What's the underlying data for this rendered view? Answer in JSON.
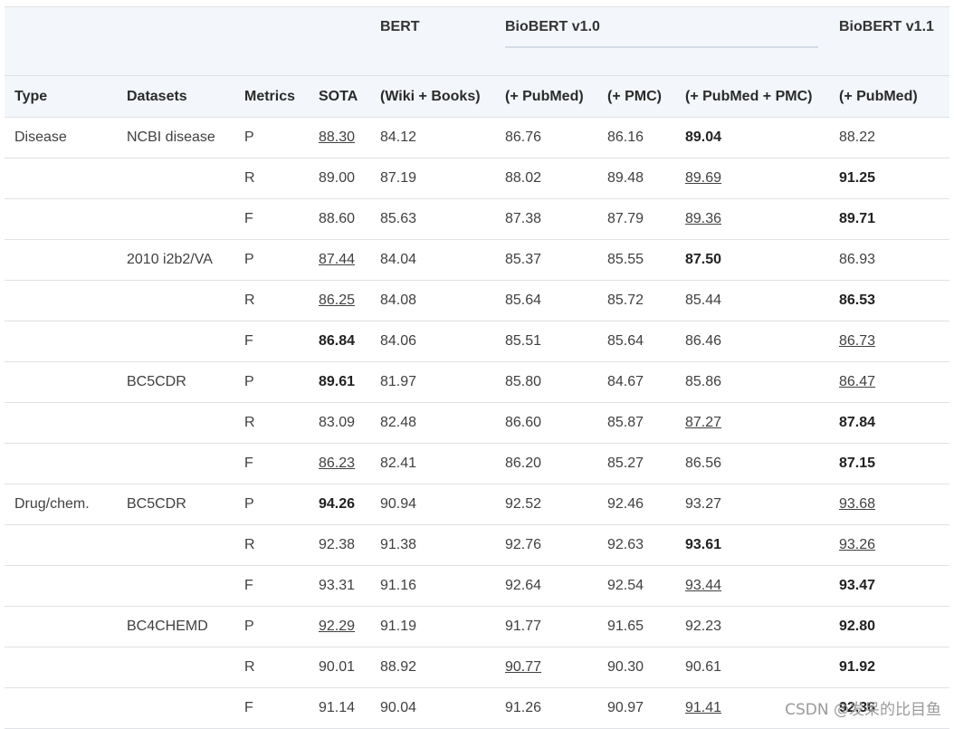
{
  "header": {
    "groups": {
      "bert": "BERT",
      "biobert_v10": "BioBERT v1.0",
      "biobert_v11": "BioBERT v1.1"
    },
    "columns": [
      "Type",
      "Datasets",
      "Metrics",
      "SOTA",
      "(Wiki + Books)",
      "(+ PubMed)",
      "(+ PMC)",
      "(+ PubMed + PMC)",
      "(+ PubMed)"
    ]
  },
  "rows": [
    {
      "cells": [
        "Disease",
        "NCBI disease",
        "P",
        "88.30",
        "84.12",
        "86.76",
        "86.16",
        "89.04",
        "88.22"
      ],
      "bold": [
        7
      ],
      "underline": [
        3
      ]
    },
    {
      "cells": [
        "",
        "",
        "R",
        "89.00",
        "87.19",
        "88.02",
        "89.48",
        "89.69",
        "91.25"
      ],
      "bold": [
        8
      ],
      "underline": [
        7
      ]
    },
    {
      "cells": [
        "",
        "",
        "F",
        "88.60",
        "85.63",
        "87.38",
        "87.79",
        "89.36",
        "89.71"
      ],
      "bold": [
        8
      ],
      "underline": [
        7
      ]
    },
    {
      "cells": [
        "",
        "2010 i2b2/VA",
        "P",
        "87.44",
        "84.04",
        "85.37",
        "85.55",
        "87.50",
        "86.93"
      ],
      "bold": [
        7
      ],
      "underline": [
        3
      ]
    },
    {
      "cells": [
        "",
        "",
        "R",
        "86.25",
        "84.08",
        "85.64",
        "85.72",
        "85.44",
        "86.53"
      ],
      "bold": [
        8
      ],
      "underline": [
        3
      ]
    },
    {
      "cells": [
        "",
        "",
        "F",
        "86.84",
        "84.06",
        "85.51",
        "85.64",
        "86.46",
        "86.73"
      ],
      "bold": [
        3
      ],
      "underline": [
        8
      ]
    },
    {
      "cells": [
        "",
        "BC5CDR",
        "P",
        "89.61",
        "81.97",
        "85.80",
        "84.67",
        "85.86",
        "86.47"
      ],
      "bold": [
        3
      ],
      "underline": [
        8
      ]
    },
    {
      "cells": [
        "",
        "",
        "R",
        "83.09",
        "82.48",
        "86.60",
        "85.87",
        "87.27",
        "87.84"
      ],
      "bold": [
        8
      ],
      "underline": [
        7
      ]
    },
    {
      "cells": [
        "",
        "",
        "F",
        "86.23",
        "82.41",
        "86.20",
        "85.27",
        "86.56",
        "87.15"
      ],
      "bold": [
        8
      ],
      "underline": [
        3
      ]
    },
    {
      "cells": [
        "Drug/chem.",
        "BC5CDR",
        "P",
        "94.26",
        "90.94",
        "92.52",
        "92.46",
        "93.27",
        "93.68"
      ],
      "bold": [
        3
      ],
      "underline": [
        8
      ]
    },
    {
      "cells": [
        "",
        "",
        "R",
        "92.38",
        "91.38",
        "92.76",
        "92.63",
        "93.61",
        "93.26"
      ],
      "bold": [
        7
      ],
      "underline": [
        8
      ]
    },
    {
      "cells": [
        "",
        "",
        "F",
        "93.31",
        "91.16",
        "92.64",
        "92.54",
        "93.44",
        "93.47"
      ],
      "bold": [
        8
      ],
      "underline": [
        7
      ]
    },
    {
      "cells": [
        "",
        "BC4CHEMD",
        "P",
        "92.29",
        "91.19",
        "91.77",
        "91.65",
        "92.23",
        "92.80"
      ],
      "bold": [
        8
      ],
      "underline": [
        3
      ]
    },
    {
      "cells": [
        "",
        "",
        "R",
        "90.01",
        "88.92",
        "90.77",
        "90.30",
        "90.61",
        "91.92"
      ],
      "bold": [
        8
      ],
      "underline": [
        5
      ]
    },
    {
      "cells": [
        "",
        "",
        "F",
        "91.14",
        "90.04",
        "91.26",
        "90.97",
        "91.41",
        "92.36"
      ],
      "bold": [
        8
      ],
      "underline": [
        7
      ]
    }
  ],
  "watermark": "CSDN @发呆的比目鱼"
}
